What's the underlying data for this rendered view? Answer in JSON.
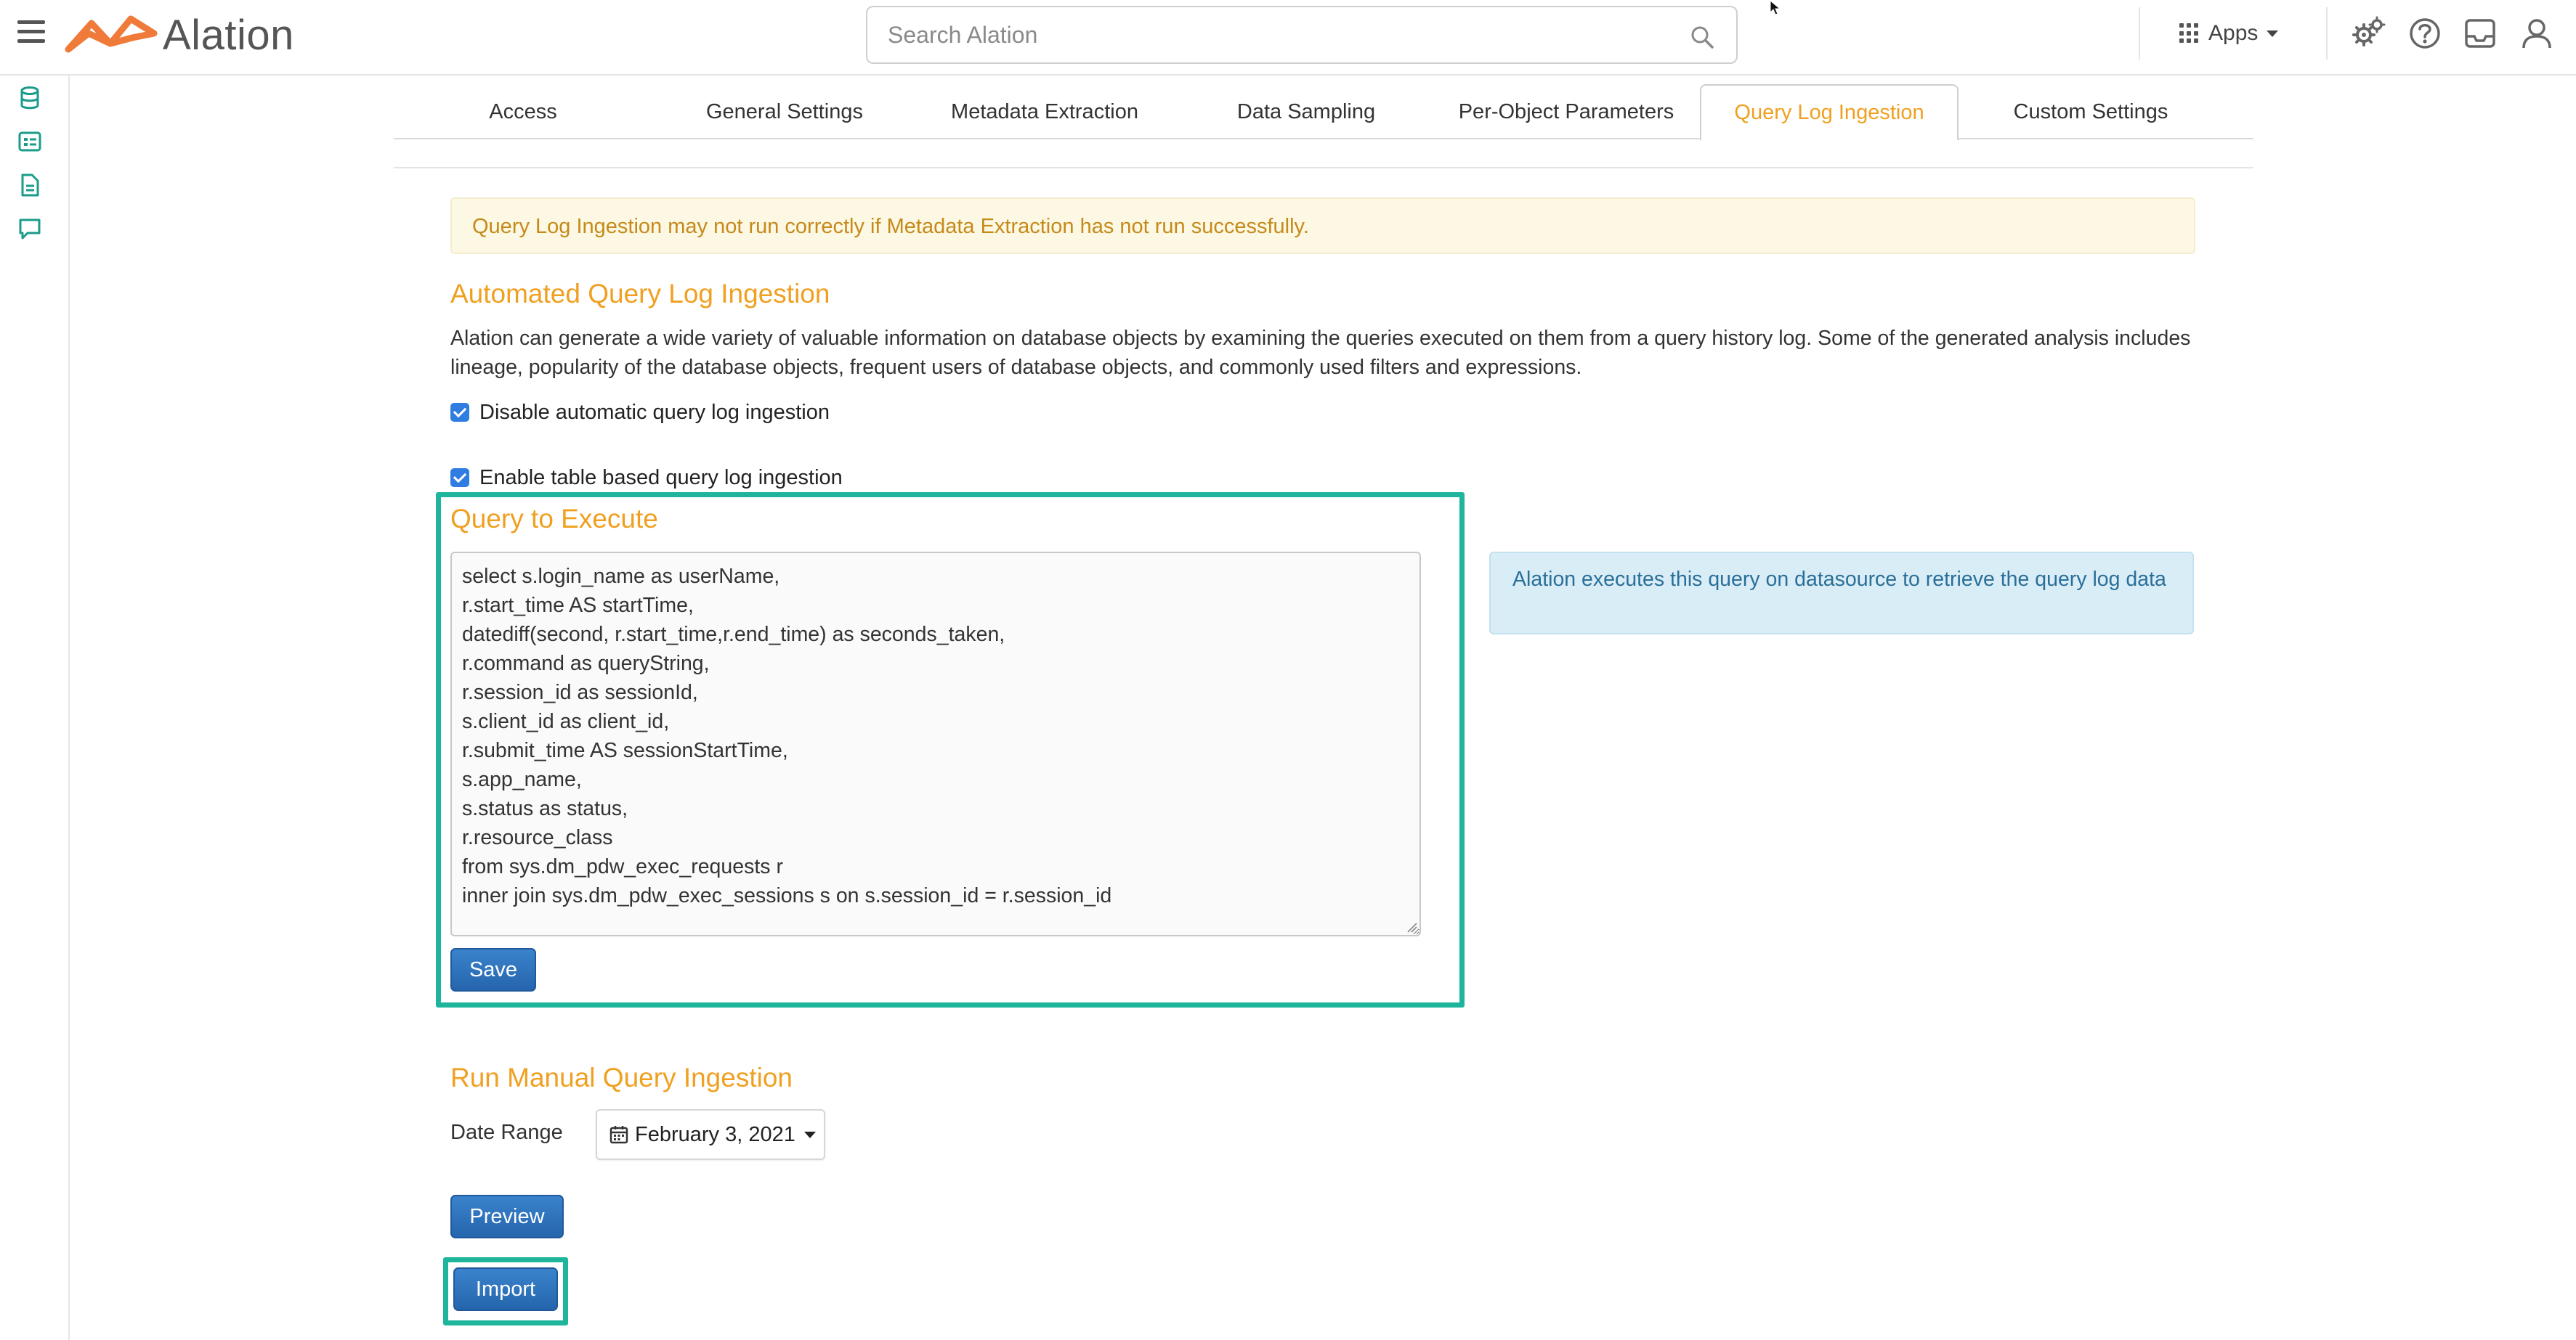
{
  "app": {
    "logo_text": "Alation",
    "brand_color": "#f07a3a",
    "accent_orange": "#f0a020",
    "highlight_color": "#1fb59c"
  },
  "header": {
    "search_placeholder": "Search Alation",
    "apps_label": "Apps",
    "icons": [
      "menu-icon",
      "search-icon",
      "apps-grid-icon",
      "settings-gears-icon",
      "help-icon",
      "inbox-icon",
      "user-icon"
    ]
  },
  "sidebar": {
    "icons": [
      "database-icon",
      "catalog-icon",
      "document-icon",
      "conversation-icon"
    ]
  },
  "tabs": [
    {
      "label": "Access",
      "active": false
    },
    {
      "label": "General Settings",
      "active": false
    },
    {
      "label": "Metadata Extraction",
      "active": false
    },
    {
      "label": "Data Sampling",
      "active": false
    },
    {
      "label": "Per-Object Parameters",
      "active": false
    },
    {
      "label": "Query Log Ingestion",
      "active": true
    },
    {
      "label": "Custom Settings",
      "active": false
    }
  ],
  "warning": "Query Log Ingestion may not run correctly if Metadata Extraction has not run successfully.",
  "automated": {
    "title": "Automated Query Log Ingestion",
    "description": "Alation can generate a wide variety of valuable information on database objects by examining the queries executed on them from a query history log. Some of the generated analysis includes lineage, popularity of the database objects, frequent users of database objects, and commonly used filters and expressions.",
    "disable_checkbox": {
      "label": "Disable automatic query log ingestion",
      "checked": true
    },
    "table_checkbox": {
      "label": "Enable table based query log ingestion",
      "checked": true
    }
  },
  "query": {
    "title": "Query to Execute",
    "text": "select s.login_name as userName,\nr.start_time AS startTime,\ndatediff(second, r.start_time,r.end_time) as seconds_taken,\nr.command as queryString,\nr.session_id as sessionId,\ns.client_id as client_id,\nr.submit_time AS sessionStartTime,\ns.app_name,\ns.status as status,\nr.resource_class\nfrom sys.dm_pdw_exec_requests r\ninner join sys.dm_pdw_exec_sessions s on s.session_id = r.session_id",
    "save_label": "Save",
    "info": "Alation executes this query on datasource to retrieve the query log data"
  },
  "manual": {
    "title": "Run Manual Query Ingestion",
    "date_range_label": "Date Range",
    "date_value": "February 3, 2021",
    "preview_label": "Preview",
    "import_label": "Import"
  }
}
